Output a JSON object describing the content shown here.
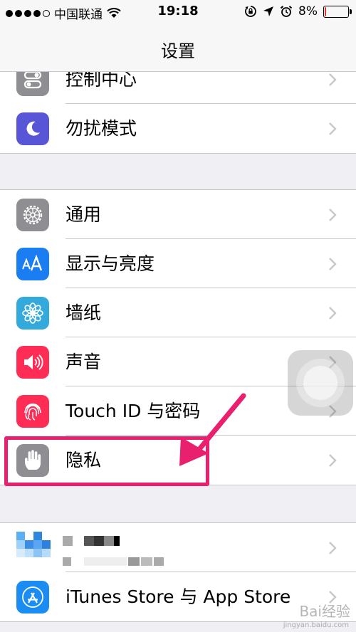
{
  "status_bar": {
    "carrier": "中国联通",
    "time": "19:18",
    "battery": "8%",
    "battery_level": 0.08
  },
  "nav": {
    "title": "设置"
  },
  "group_top": [
    {
      "label": "控制中心",
      "icon": "control-center-icon",
      "color": "#8e8e93"
    },
    {
      "label": "勿扰模式",
      "icon": "moon-icon",
      "color": "#5856d6"
    }
  ],
  "group_main": [
    {
      "label": "通用",
      "icon": "gear-icon",
      "color": "#8e8e93"
    },
    {
      "label": "显示与亮度",
      "icon": "text-size-icon",
      "color": "#1a7df2"
    },
    {
      "label": "墙纸",
      "icon": "flower-icon",
      "color": "#34aadc"
    },
    {
      "label": "声音",
      "icon": "speaker-icon",
      "color": "#ff2d55"
    },
    {
      "label": "Touch ID 与密码",
      "icon": "fingerprint-icon",
      "color": "#ff2d55"
    },
    {
      "label": "隐私",
      "icon": "hand-icon",
      "color": "#8e8e93"
    }
  ],
  "group_bottom": [
    {
      "label": "iTunes Store 与 App Store",
      "icon": "app-store-icon",
      "color": "#1a8cf2"
    }
  ],
  "highlight": {
    "color": "#e8206e"
  },
  "watermark": {
    "text": "Bai经验",
    "sub": "jingyan.baidu.com"
  }
}
